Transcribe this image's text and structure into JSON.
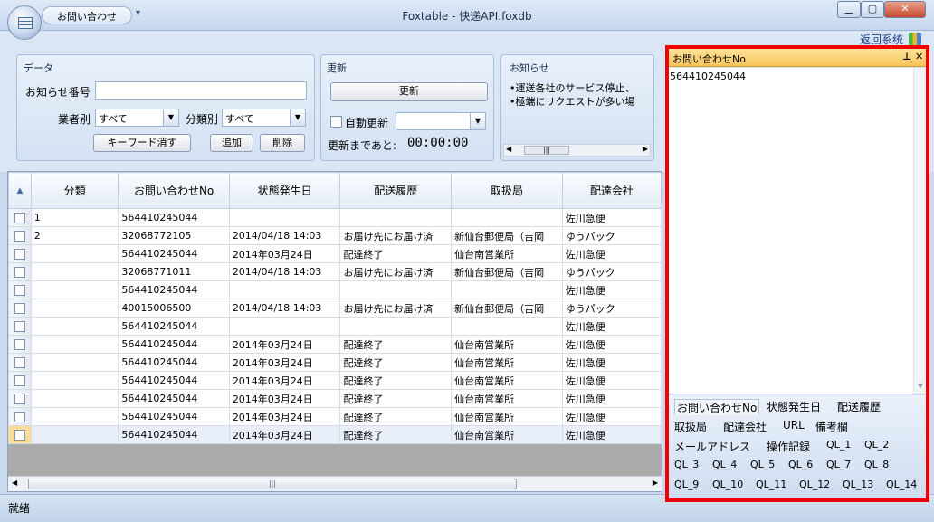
{
  "window": {
    "title": "Foxtable - 快递API.foxdb",
    "tab_label": "お問い合わせ"
  },
  "ribbon": {
    "return_link": "返回系统",
    "data_group": {
      "label": "データ",
      "notice_no_label": "お知らせ番号",
      "notice_no_value": "",
      "vendor_label": "業者別",
      "vendor_value": "すべて",
      "category_label": "分類別",
      "category_value": "すべて",
      "clear_keyword_btn": "キーワード消す",
      "add_btn": "追加",
      "delete_btn": "削除"
    },
    "update_group": {
      "label": "更新",
      "update_btn": "更新",
      "auto_update_label": "自動更新",
      "auto_update_checked": false,
      "interval_value": "",
      "countdown_label": "更新まであと:",
      "countdown_value": "00:00:00"
    },
    "notice_group": {
      "label": "お知らせ",
      "lines": [
        "•運送各社のサービス停止、",
        "•極端にリクエストが多い場"
      ]
    }
  },
  "grid": {
    "columns": [
      "分類",
      "お問い合わせNo",
      "状態発生日",
      "配送履歴",
      "取扱局",
      "配達会社"
    ],
    "rows": [
      [
        "1",
        "564410245044",
        "",
        "",
        "",
        "佐川急便"
      ],
      [
        "2",
        "32068772105",
        "2014/04/18 14:03",
        "お届け先にお届け済",
        "新仙台郵便局（吉岡",
        "ゆうパック"
      ],
      [
        "",
        "564410245044",
        "2014年03月24日",
        "配達終了",
        "仙台南営業所",
        "佐川急便"
      ],
      [
        "",
        "32068771011",
        "2014/04/18 14:03",
        "お届け先にお届け済",
        "新仙台郵便局（吉岡",
        "ゆうパック"
      ],
      [
        "",
        "564410245044",
        "",
        "",
        "",
        "佐川急便"
      ],
      [
        "",
        "40015006500",
        "2014/04/18 14:03",
        "お届け先にお届け済",
        "新仙台郵便局（吉岡",
        "ゆうパック"
      ],
      [
        "",
        "564410245044",
        "",
        "",
        "",
        "佐川急便"
      ],
      [
        "",
        "564410245044",
        "2014年03月24日",
        "配達終了",
        "仙台南営業所",
        "佐川急便"
      ],
      [
        "",
        "564410245044",
        "2014年03月24日",
        "配達終了",
        "仙台南営業所",
        "佐川急便"
      ],
      [
        "",
        "564410245044",
        "2014年03月24日",
        "配達終了",
        "仙台南営業所",
        "佐川急便"
      ],
      [
        "",
        "564410245044",
        "2014年03月24日",
        "配達終了",
        "仙台南営業所",
        "佐川急便"
      ],
      [
        "",
        "564410245044",
        "2014年03月24日",
        "配達終了",
        "仙台南営業所",
        "佐川急便"
      ],
      [
        "",
        "564410245044",
        "2014年03月24日",
        "配達終了",
        "仙台南営業所",
        "佐川急便"
      ]
    ],
    "selected_row": 12
  },
  "panel": {
    "title": "お問い合わせNo",
    "value": "564410245044",
    "fields": [
      [
        "お問い合わせNo",
        "状態発生日",
        "配送履歴"
      ],
      [
        "取扱局",
        "配達会社",
        "URL",
        "備考欄"
      ],
      [
        "メールアドレス",
        "操作記録",
        "QL_1",
        "QL_2"
      ],
      [
        "QL_3",
        "QL_4",
        "QL_5",
        "QL_6",
        "QL_7",
        "QL_8"
      ],
      [
        "QL_9",
        "QL_10",
        "QL_11",
        "QL_12",
        "QL_13",
        "QL_14"
      ]
    ]
  },
  "status": {
    "text": "就绪"
  }
}
